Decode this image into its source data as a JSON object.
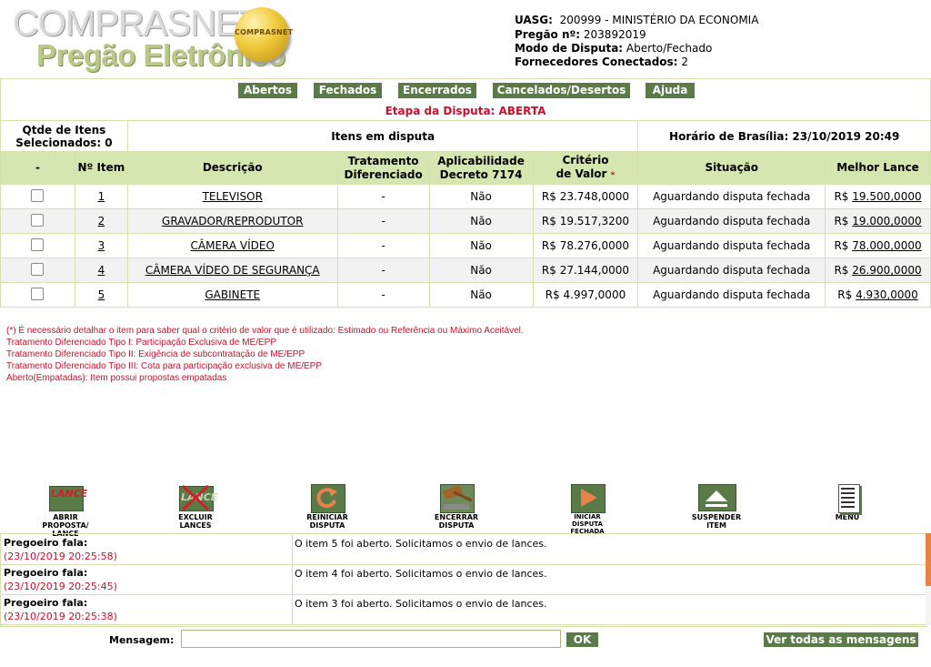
{
  "logo": {
    "title": "COMPRASNET",
    "subtitle": "Pregão Eletrônico",
    "seal": "COMPRASNET"
  },
  "info": {
    "uasg_label": "UASG:",
    "uasg_value": "200999 - MINISTÉRIO DA ECONOMIA",
    "pregao_label": "Pregão nº:",
    "pregao_value": "203892019",
    "modo_label": "Modo de Disputa:",
    "modo_value": "Aberto/Fechado",
    "forn_label": "Fornecedores Conectados:",
    "forn_value": "2"
  },
  "tabs": [
    "Abertos",
    "Fechados",
    "Encerrados",
    "Cancelados/Desertos",
    "Ajuda"
  ],
  "etapa": "Etapa da Disputa: ABERTA",
  "summary": {
    "qtde_line1": "Qtde de Itens",
    "qtde_line2": "Selecionados: 0",
    "itens": "Itens em disputa",
    "horario": "Horário de Brasília: 23/10/2019 20:49"
  },
  "headers": {
    "sel": "-",
    "item": "Nº Item",
    "desc": "Descrição",
    "trat1": "Tratamento",
    "trat2": "Diferenciado",
    "apl1": "Aplicabilidade",
    "apl2": "Decreto 7174",
    "crit1": "Critério",
    "crit2": "de Valor",
    "star": "*",
    "sit": "Situação",
    "melhor": "Melhor Lance"
  },
  "rows": [
    {
      "item": "1",
      "desc": "TELEVISOR",
      "trat": "-",
      "apl": "Não",
      "crit": "R$ 23.748,0000",
      "sit": "Aguardando disputa fechada",
      "cur": "R$",
      "lance": "19.500,0000"
    },
    {
      "item": "2",
      "desc": "GRAVADOR/REPRODUTOR",
      "trat": "-",
      "apl": "Não",
      "crit": "R$ 19.517,3200",
      "sit": "Aguardando disputa fechada",
      "cur": "R$",
      "lance": "19.000,0000"
    },
    {
      "item": "3",
      "desc": "CÂMERA VÍDEO",
      "trat": "-",
      "apl": "Não",
      "crit": "R$ 78.276,0000",
      "sit": "Aguardando disputa fechada",
      "cur": "R$",
      "lance": "78.000,0000"
    },
    {
      "item": "4",
      "desc": "CÂMERA VÍDEO DE SEGURANÇA",
      "trat": "-",
      "apl": "Não",
      "crit": "R$ 27.144,0000",
      "sit": "Aguardando disputa fechada",
      "cur": "R$",
      "lance": "26.900,0000"
    },
    {
      "item": "5",
      "desc": "GABINETE",
      "trat": "-",
      "apl": "Não",
      "crit": "R$ 4.997,0000",
      "sit": "Aguardando disputa fechada",
      "cur": "R$",
      "lance": "4.930,0000"
    }
  ],
  "notes": [
    "(*) É necessário detalhar o item para saber qual o critério de valor que é utilizado: Estimado ou Referência ou Máximo Aceitável.",
    "Tratamento Diferenciado Tipo I: Participação Exclusiva de ME/EPP",
    "Tratamento Diferenciado Tipo II: Exigência de subcontratação de ME/EPP",
    "Tratamento Diferenciado Tipo III: Cota para participação exclusiva de ME/EPP",
    "Aberto(Empatadas): Item possui propostas empatadas"
  ],
  "actions": {
    "lance_icon_text": "LANCE",
    "abrir": [
      "ABRIR",
      "PROPOSTA/",
      "LANCE"
    ],
    "excluir": [
      "EXCLUIR",
      "LANCES"
    ],
    "reiniciar": [
      "REINICIAR",
      "DISPUTA"
    ],
    "encerrar": [
      "ENCERRAR",
      "DISPUTA"
    ],
    "iniciar": [
      "INICIAR",
      "DISPUTA",
      "FECHADA"
    ],
    "suspender": [
      "SUSPENDER",
      "ITEM"
    ],
    "menu": [
      "MENU"
    ]
  },
  "messages": [
    {
      "who": "Pregoeiro fala:",
      "time": "(23/10/2019 20:25:58)",
      "text": "O item 5 foi aberto. Solicitamos o envio de lances."
    },
    {
      "who": "Pregoeiro fala:",
      "time": "(23/10/2019 20:25:45)",
      "text": "O item 4 foi aberto. Solicitamos o envio de lances."
    },
    {
      "who": "Pregoeiro fala:",
      "time": "(23/10/2019 20:25:38)",
      "text": "O item 3 foi aberto. Solicitamos o envio de lances."
    }
  ],
  "footer": {
    "mensagem_label": "Mensagem:",
    "mensagem_value": "",
    "ok": "OK",
    "ver_todas": "Ver todas as mensagens"
  },
  "colors": {
    "green": "#5a7a47",
    "header_bg": "#d6e6b0",
    "red": "#c8102e",
    "border": "#d6dfb0"
  }
}
